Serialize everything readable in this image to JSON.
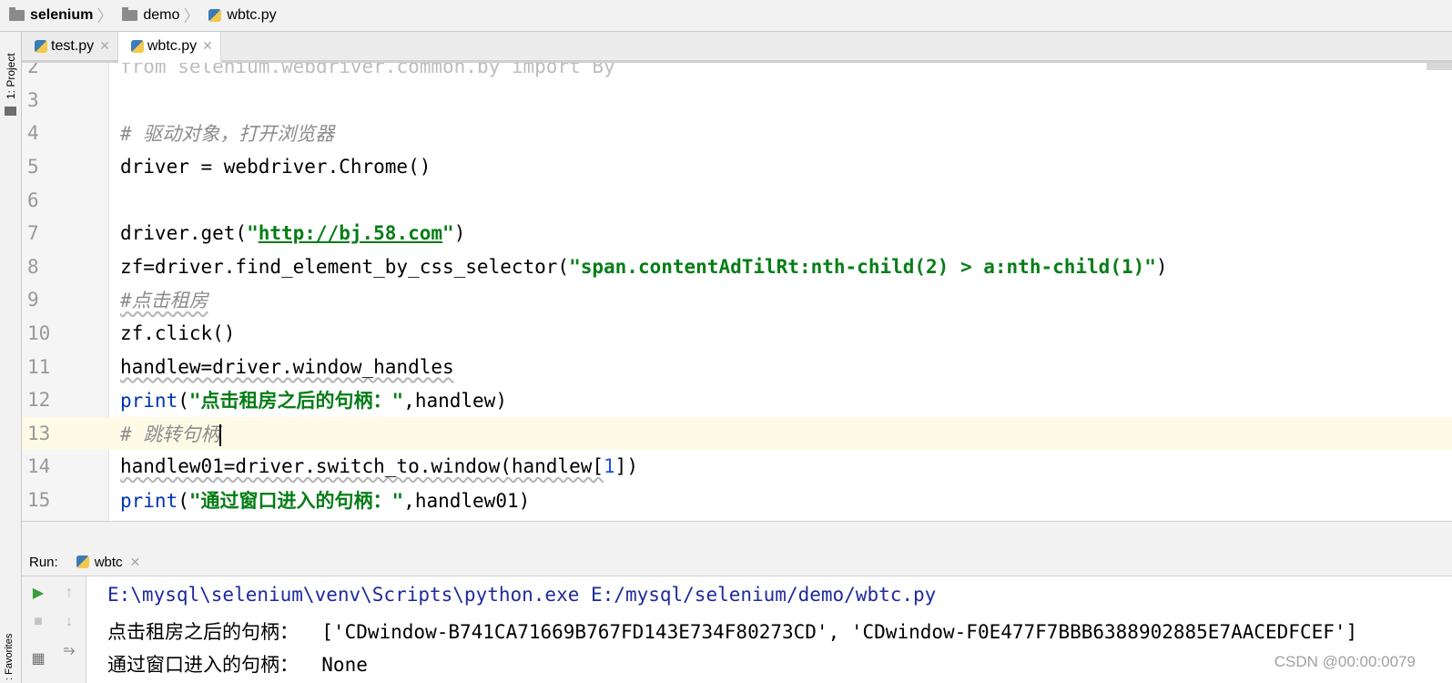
{
  "breadcrumb": {
    "items": [
      "selenium",
      "demo",
      "wbtc.py"
    ]
  },
  "left_strip": {
    "project_label": "1: Project",
    "favorites_label": ": Favorites"
  },
  "tabs": [
    {
      "label": "test.py",
      "active": false
    },
    {
      "label": "wbtc.py",
      "active": true
    }
  ],
  "editor": {
    "lines": [
      {
        "n": "2",
        "text": "from selenium.webdriver.common.by import By"
      },
      {
        "n": "3",
        "text": ""
      },
      {
        "n": "4",
        "text": "# 驱动对象，打开浏览器"
      },
      {
        "n": "5",
        "text": "driver = webdriver.Chrome()"
      },
      {
        "n": "6",
        "text": ""
      },
      {
        "n": "7",
        "text": "driver.get(\"http://bj.58.com\")"
      },
      {
        "n": "8",
        "text": "zf=driver.find_element_by_css_selector(\"span.contentAdTilRt:nth-child(2) > a:nth-child(1)\")"
      },
      {
        "n": "9",
        "text": "#点击租房"
      },
      {
        "n": "10",
        "text": "zf.click()"
      },
      {
        "n": "11",
        "text": "handlew=driver.window_handles"
      },
      {
        "n": "12",
        "text": "print(\"点击租房之后的句柄：\",handlew)"
      },
      {
        "n": "13",
        "text": "# 跳转句柄"
      },
      {
        "n": "14",
        "text": "handlew01=driver.switch_to.window(handlew[1])"
      },
      {
        "n": "15",
        "text": "print(\"通过窗口进入的句柄：\",handlew01)"
      }
    ],
    "current_line": "13"
  },
  "code": {
    "l2_from": "from",
    "l2_mod": " selenium.webdriver.common.by ",
    "l2_import": "import",
    "l2_by": " By",
    "l4": "# 驱动对象，打开浏览器",
    "l5": "driver = webdriver.Chrome()",
    "l7_a": "driver.get(",
    "l7_q1": "\"",
    "l7_url": "http://bj.58.com",
    "l7_q2": "\"",
    "l7_b": ")",
    "l8_a": "zf=driver.find_element_by_css_selector(",
    "l8_str": "\"span.contentAdTilRt:nth-child(2) > a:nth-child(1)\"",
    "l8_b": ")",
    "l9": "#点击租房",
    "l10": "zf.click()",
    "l11": "handlew=driver.window_handles",
    "l12_print": "print",
    "l12_open": "(",
    "l12_str": "\"点击租房之后的句柄：\"",
    "l12_rest": ",handlew)",
    "l13": "# 跳转句柄",
    "l14_a": "handlew01=driver.switch_to.window(handlew[",
    "l14_num": "1",
    "l14_b": "])",
    "l15_print": "print",
    "l15_open": "(",
    "l15_str": "\"通过窗口进入的句柄：\"",
    "l15_rest": ",handlew01)"
  },
  "run_panel": {
    "label": "Run:",
    "tab_label": "wbtc",
    "output": [
      "E:\\mysql\\selenium\\venv\\Scripts\\python.exe E:/mysql/selenium/demo/wbtc.py",
      "点击租房之后的句柄：  ['CDwindow-B741CA71669B767FD143E734F80273CD', 'CDwindow-F0E477F7BBB6388902885E7AACEDFCEF']",
      "通过窗口进入的句柄：  None"
    ]
  },
  "watermark": "CSDN @00:00:0079",
  "colors": {
    "keyword": "#0033b3",
    "string": "#067d17",
    "comment": "#8c8c8c",
    "current_line": "#fdfbe6",
    "run_command": "#1d2a9e"
  }
}
